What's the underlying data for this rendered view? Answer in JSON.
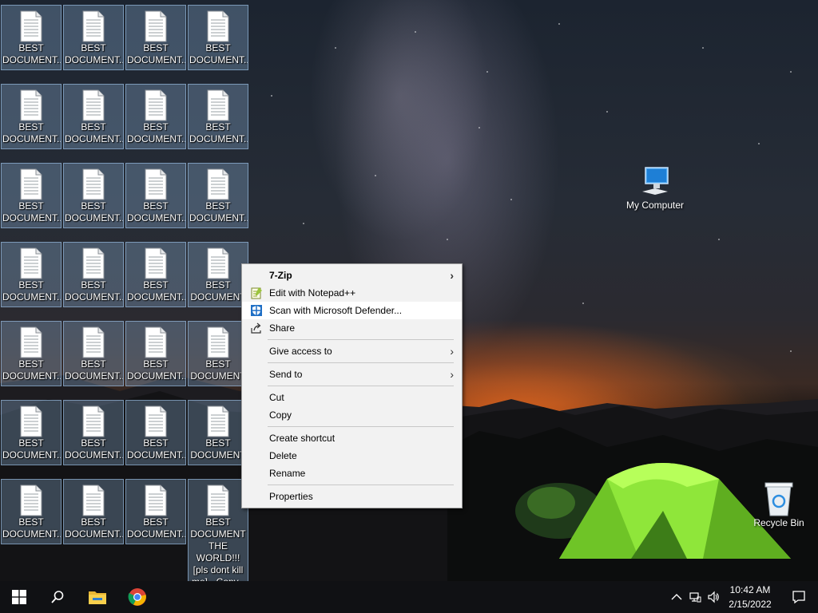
{
  "desktop": {
    "doc_icon_label": "BEST\nDOCUMENT...",
    "doc_icon_label_partial": "BEST\nDOCUMENT",
    "selected_icon_label": "BEST\nDOCUMENT\nTHE WORLD!!!\n[pls dont kill\nme] - Copy -",
    "my_computer_label": "My Computer",
    "recycle_bin_label": "Recycle Bin"
  },
  "context_menu": {
    "items": [
      {
        "label": "7-Zip",
        "bold": true,
        "submenu": true
      },
      {
        "label": "Edit with Notepad++",
        "icon": "notepadpp-icon"
      },
      {
        "label": "Scan with Microsoft Defender...",
        "icon": "defender-shield-icon",
        "highlighted": true
      },
      {
        "label": "Share",
        "icon": "share-icon"
      },
      {
        "label": "Give access to",
        "submenu": true
      },
      {
        "label": "Send to",
        "submenu": true
      },
      {
        "label": "Cut"
      },
      {
        "label": "Copy"
      },
      {
        "label": "Create shortcut"
      },
      {
        "label": "Delete"
      },
      {
        "label": "Rename"
      },
      {
        "label": "Properties"
      }
    ],
    "submenu_arrow": ">"
  },
  "taskbar": {
    "start_icon": "windows-logo-icon",
    "search_icon": "search-icon",
    "pinned": [
      "file-explorer-icon",
      "chrome-icon"
    ],
    "tray_icons": [
      "chevron-up-icon",
      "network-icon",
      "volume-icon"
    ],
    "time": "10:42 AM",
    "date": "2/15/2022",
    "notification_icon": "action-center-icon"
  },
  "colors": {
    "taskbar_bg": "#101114",
    "menu_bg": "#f2f2f2",
    "icon_selection": "#96bee6",
    "tent_green": "#8fe63a"
  }
}
